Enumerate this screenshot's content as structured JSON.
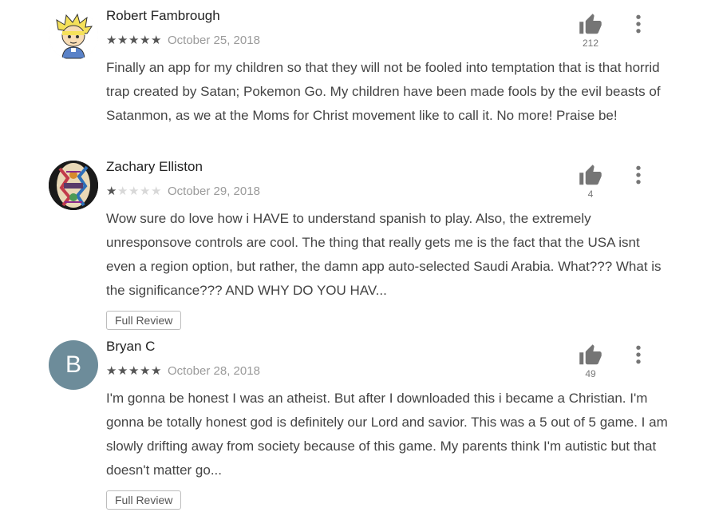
{
  "reviews": [
    {
      "author": "Robert Fambrough",
      "rating": 5,
      "max_rating": 5,
      "date": "October 25, 2018",
      "text": "Finally an app for my children so that they will not be fooled into temptation that is that horrid trap created by Satan; Pokemon Go. My children have been made fools by the evil beasts of Satanmon, as we at the Moms for Christ movement like to call it. No more! Praise be!",
      "helpful_count": "212",
      "avatar": "cartoon-boy-icon"
    },
    {
      "author": "Zachary Elliston",
      "rating": 1,
      "max_rating": 5,
      "date": "October 29, 2018",
      "text": "Wow sure do love how i HAVE to understand spanish to play. Also, the extremely unresponsove controls are cool. The thing that really gets me is the fact that the USA isnt even a region option, but rather, the damn app auto-selected Saudi Arabia. What??? What is the significance??? AND WHY DO YOU HAV...",
      "helpful_count": "4",
      "avatar": "colorful-pattern-icon",
      "full_review_label": "Full Review"
    },
    {
      "author": "Bryan C",
      "rating": 5,
      "max_rating": 5,
      "date": "October 28, 2018",
      "text": "I'm gonna be honest I was an atheist. But after I downloaded this i became a Christian. I'm gonna be totally honest god is definitely our Lord and savior. This was a 5 out of 5 game. I am slowly drifting away from society because of this game. My parents think I'm autistic but that doesn't matter go...",
      "helpful_count": "49",
      "avatar_letter": "B",
      "full_review_label": "Full Review"
    }
  ],
  "colors": {
    "avatar_letter_bg": "#6d8c9a",
    "star_filled": "#555555",
    "star_empty": "#d8d8d8",
    "icon_gray": "#757575"
  },
  "icons": {
    "helpful": "thumb-up-icon",
    "menu": "more-vert-icon"
  }
}
